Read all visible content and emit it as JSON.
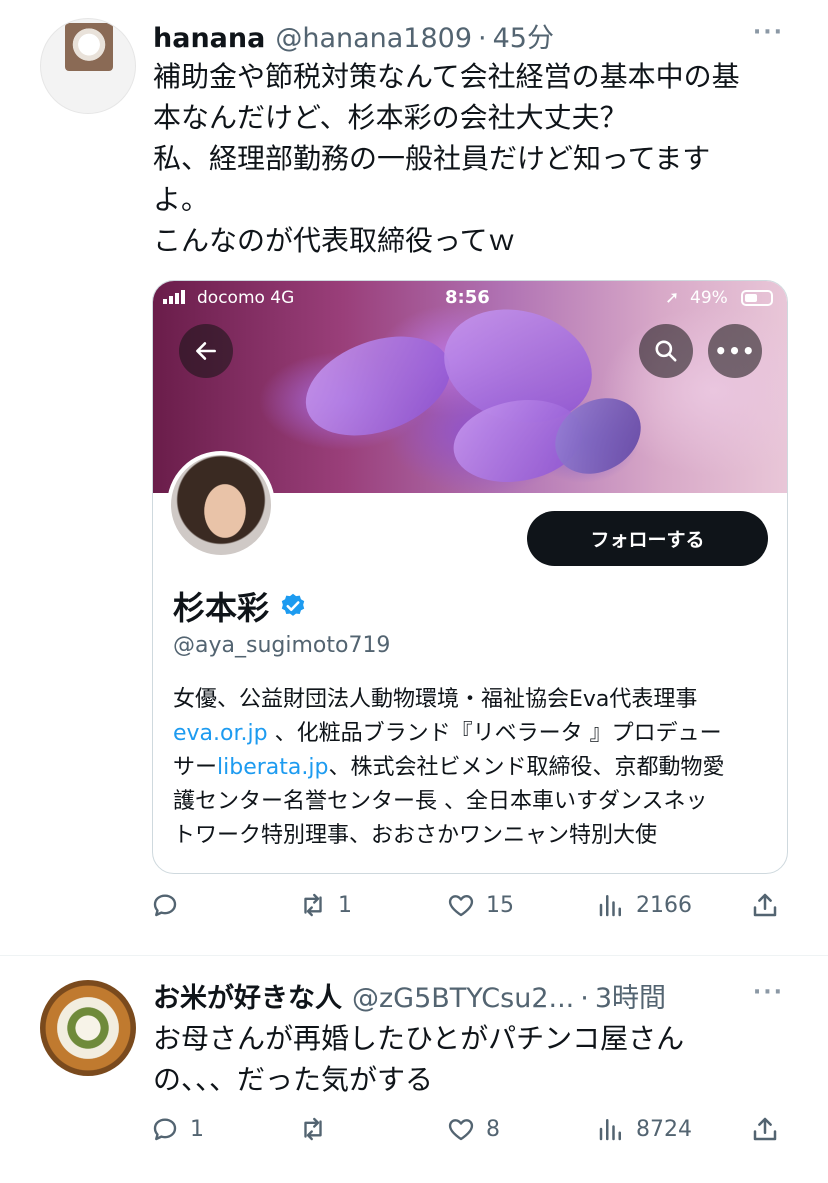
{
  "tweets": [
    {
      "name": "hanana",
      "handle": "@hanana1809",
      "separator": "·",
      "time": "45分",
      "more": "···",
      "lines": [
        "補助金や節税対策なんて会社経営の基本中の基",
        "本なんだけど、杉本彩の会社大丈夫？",
        "私、経理部勤務の一般社員だけど知ってます",
        "よ。",
        "こんなのが代表取締役ってｗ"
      ],
      "actions": {
        "reply": "",
        "retweet": "1",
        "like": "15",
        "views": "2166"
      },
      "embedded_screenshot": {
        "status_bar": {
          "carrier": "docomo  4G",
          "time": "8:56",
          "battery": "49%"
        },
        "profile": {
          "follow_label": "フォローする",
          "name": "杉本彩",
          "handle": "@aya_sugimoto719",
          "bio": {
            "line1": "女優、公益財団法人動物環境・福祉協会Eva代表理事",
            "line2_link": "eva.or.jp",
            "line2_rest": " 、化粧品ブランド『リベラータ 』プロデュー",
            "line3_start": "サー",
            "line3_link": "liberata.jp",
            "line3_rest": "、株式会社ビメンド取締役、京都動物愛",
            "line4": "護センター名誉センター長 、全日本車いすダンスネッ",
            "line5": "トワーク特別理事、おおさかワンニャン特別大使"
          }
        }
      }
    },
    {
      "name": "お米が好きな人",
      "handle": "@zG5BTYCsu2...",
      "separator": "·",
      "time": "3時間",
      "more": "···",
      "lines": [
        "お母さんが再婚したひとがパチンコ屋さん",
        "の、、、だった気がする"
      ],
      "actions": {
        "reply": "1",
        "retweet": "",
        "like": "8",
        "views": "8724"
      }
    }
  ],
  "colors": {
    "text": "#0f1419",
    "secondary": "#536471",
    "link": "#1d9bf0",
    "border": "#cfd9de"
  }
}
